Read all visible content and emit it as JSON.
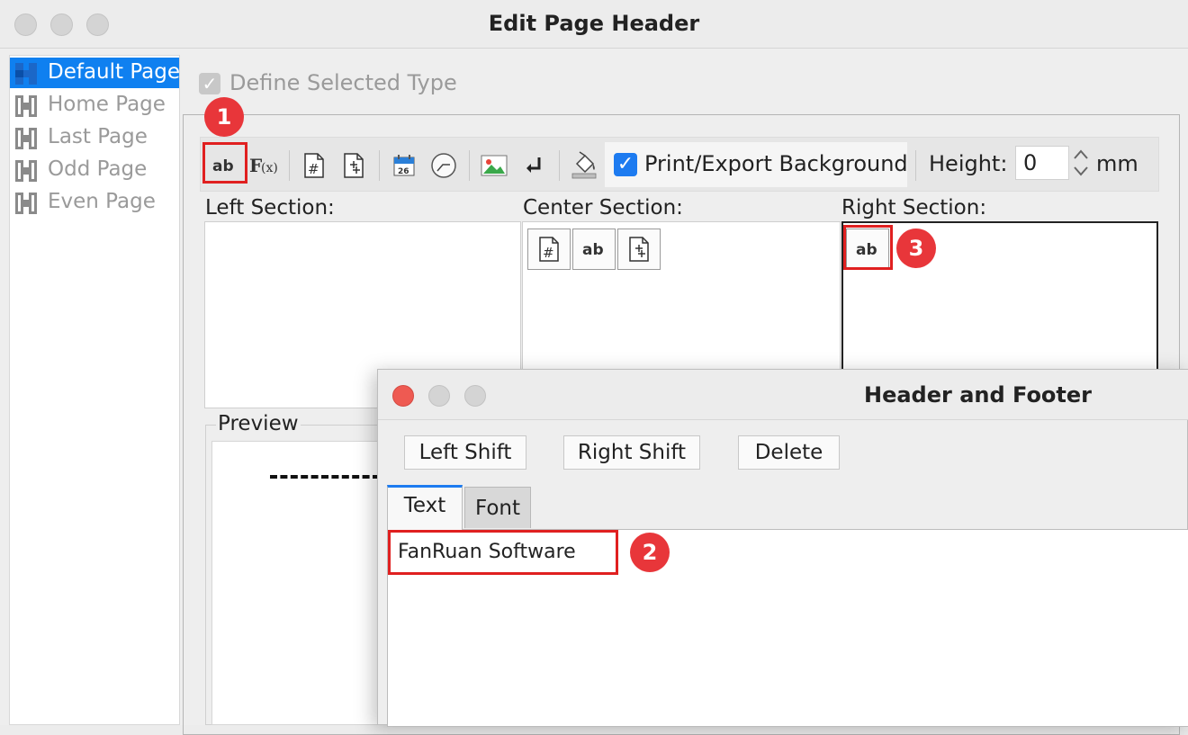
{
  "window": {
    "title": "Edit Page Header"
  },
  "page_types": [
    {
      "label": "Default Page",
      "selected": true
    },
    {
      "label": "Home Page",
      "selected": false
    },
    {
      "label": "Last Page",
      "selected": false
    },
    {
      "label": "Odd Page",
      "selected": false
    },
    {
      "label": "Even Page",
      "selected": false
    }
  ],
  "define_selected_type": {
    "label": "Define Selected Type",
    "checked": true,
    "enabled": false
  },
  "toolbar": {
    "print_export_background": {
      "label": "Print/Export Background",
      "checked": true
    },
    "height": {
      "label": "Height:",
      "value": "0",
      "unit": "mm"
    }
  },
  "sections": {
    "left": {
      "label": "Left Section:"
    },
    "center": {
      "label": "Center Section:"
    },
    "right": {
      "label": "Right Section:"
    }
  },
  "preview": {
    "label": "Preview"
  },
  "badges": {
    "one": "1",
    "two": "2",
    "three": "3"
  },
  "dialog": {
    "title": "Header and Footer",
    "buttons": {
      "left_shift": "Left Shift",
      "right_shift": "Right Shift",
      "delete": "Delete"
    },
    "tabs": {
      "text": "Text",
      "font": "Font"
    },
    "text_value": "FanRuan Software"
  },
  "colors": {
    "accent": "#1d7bf0",
    "selection": "#0f80f0",
    "highlight": "#e02020",
    "badge": "#e8363a"
  }
}
